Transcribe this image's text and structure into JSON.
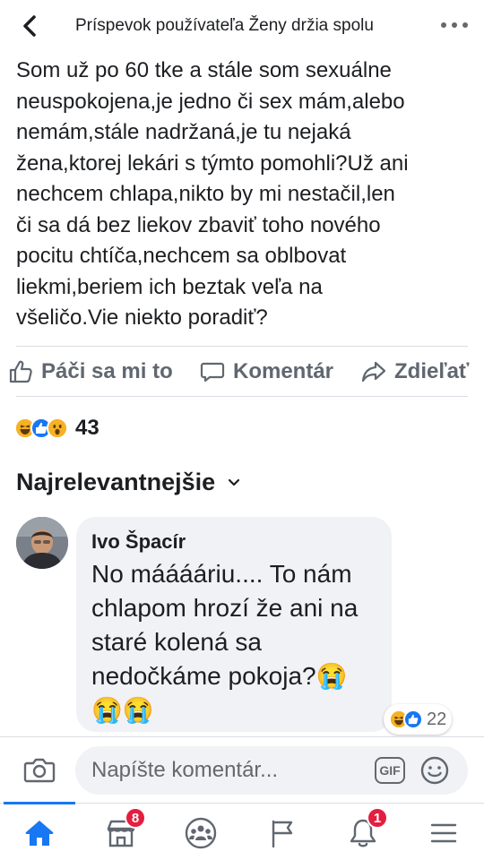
{
  "header": {
    "title": "Príspevok používateľa Ženy držia spolu",
    "back_icon": "chevron-left-icon",
    "more_icon": "more-horizontal-icon"
  },
  "post": {
    "lines": [
      "Som už po 60 tke a stále som sexuálne",
      "neuspokojena,je jedno či sex mám,alebo",
      "nemám,stále nadržaná,je tu nejaká",
      "žena,ktorej lekári s týmto pomohli?Už ani",
      "nechcem chlapa,nikto by mi nestačil,len",
      "či sa dá bez liekov zbaviť toho nového",
      "pocitu chtíča,nechcem sa oblbovat",
      "liekmi,beriem ich beztak veľa na",
      "všeličo.Vie niekto poradiť?"
    ]
  },
  "actions": {
    "like_label": "Páči sa mi to",
    "comment_label": "Komentár",
    "share_label": "Zdieľať"
  },
  "reactions": {
    "icons": [
      "haha",
      "like",
      "wow"
    ],
    "count": "43"
  },
  "sort": {
    "label": "Najrelevantnejšie"
  },
  "comment": {
    "author": "Ivo Špacír",
    "lines": [
      "No mááááriu.... To nám",
      "chlapom hrozí že ani na",
      "staré kolená sa",
      "nedočkáme pokoja?😭",
      "😭😭"
    ],
    "reactions": {
      "icons": [
        "haha",
        "like"
      ],
      "count": "22"
    }
  },
  "composer": {
    "placeholder": "Napíšte komentár...",
    "gif_label": "GIF"
  },
  "nav": {
    "marketplace_badge": "8",
    "notifications_badge": "1"
  },
  "colors": {
    "accent": "#1877f2",
    "text_muted": "#606770",
    "badge": "#e41e3f",
    "bubble": "#f0f2f5"
  }
}
